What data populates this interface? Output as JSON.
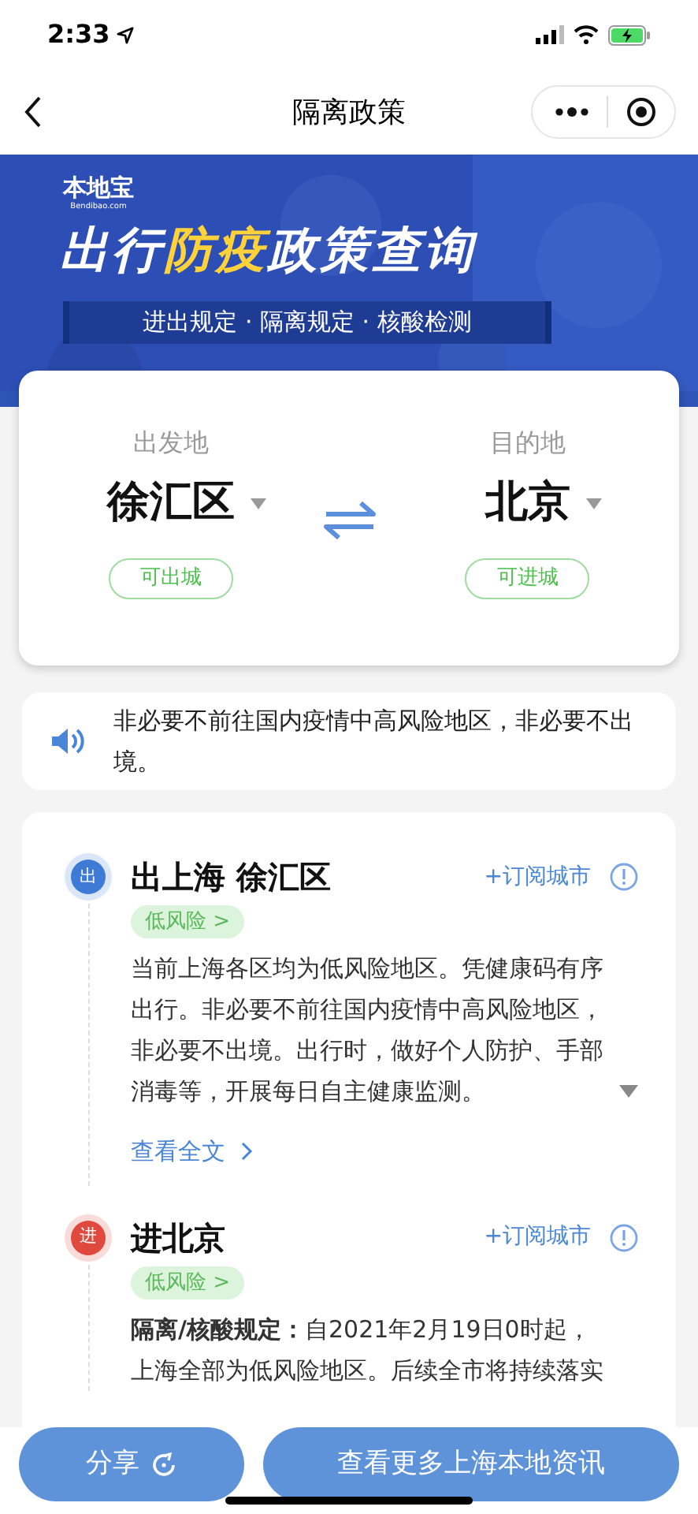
{
  "status_bar": {
    "time": "2:33"
  },
  "nav": {
    "title": "隔离政策"
  },
  "banner": {
    "logo": "本地宝",
    "logo_sub": "Bendibao.com",
    "title_parts": [
      {
        "text": "出行",
        "highlight": false
      },
      {
        "text": "防疫",
        "highlight": true
      },
      {
        "text": "政策查询",
        "highlight": false
      }
    ],
    "subtitle": "进出规定 · 隔离规定 · 核酸检测"
  },
  "route": {
    "origin": {
      "label": "出发地",
      "place": "徐汇区",
      "status": "可出城"
    },
    "destination": {
      "label": "目的地",
      "place": "北京",
      "status": "可进城"
    }
  },
  "notice": {
    "text": "非必要不前往国内疫情中高风险地区，非必要不出境。"
  },
  "sections": [
    {
      "kind": "exit",
      "badge": "出",
      "title": "出上海 徐汇区",
      "subscribe": "+订阅城市",
      "risk": "低风险 >",
      "body": "当前上海各区均为低风险地区。凭健康码有序出行。非必要不前往国内疫情中高风险地区，非必要不出境。出行时，做好个人防护、手部消毒等，开展每日自主健康监测。",
      "collapsed": true,
      "more": "查看全文"
    },
    {
      "kind": "entry",
      "badge": "进",
      "title": "进北京",
      "subscribe": "+订阅城市",
      "risk": "低风险 >",
      "body": "**隔离/核酸规定：**自2021年2月19日0时起，上海全部为低风险地区。后续全市将持续落实",
      "collapsed": false
    }
  ],
  "bottom_buttons": [
    {
      "label": "分享",
      "kind": "share"
    },
    {
      "label": "查看更多上海本地资讯",
      "kind": "plain"
    }
  ]
}
